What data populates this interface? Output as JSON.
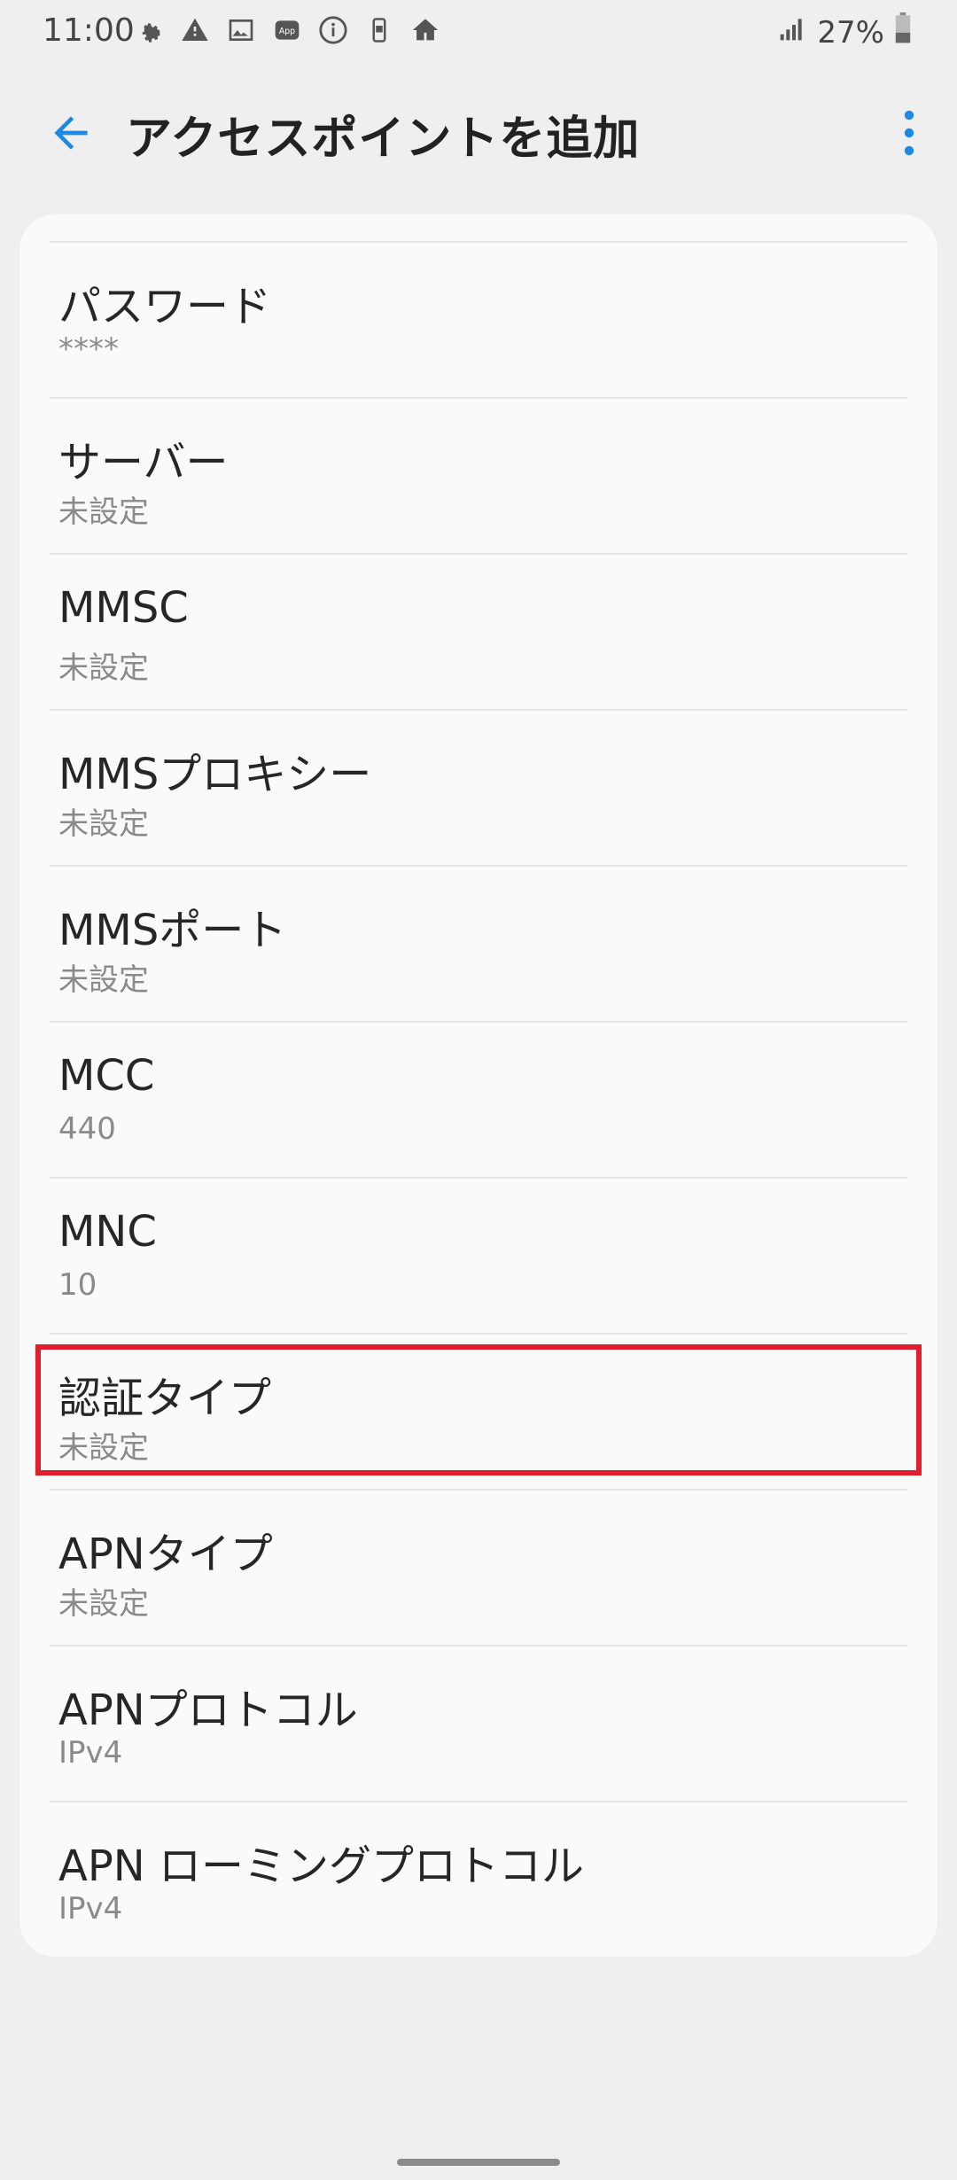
{
  "status_bar": {
    "time": "11:00",
    "battery_percent": "27%",
    "left_icons": [
      "gear-icon",
      "warning-icon",
      "image-icon",
      "app-icon",
      "info-icon",
      "device-icon",
      "home-icon"
    ],
    "right_icons": [
      "signal-icon",
      "battery-icon"
    ]
  },
  "app_bar": {
    "title": "アクセスポイントを追加",
    "accent_color": "#1e88e5"
  },
  "items": [
    {
      "title": "パスワード",
      "value": "****"
    },
    {
      "title": "サーバー",
      "value": "未設定"
    },
    {
      "title": "MMSC",
      "value": "未設定"
    },
    {
      "title": "MMSプロキシー",
      "value": "未設定"
    },
    {
      "title": "MMSポート",
      "value": "未設定"
    },
    {
      "title": "MCC",
      "value": "440"
    },
    {
      "title": "MNC",
      "value": "10"
    },
    {
      "title": "認証タイプ",
      "value": "未設定"
    },
    {
      "title": "APNタイプ",
      "value": "未設定"
    },
    {
      "title": "APNプロトコル",
      "value": "IPv4"
    },
    {
      "title": "APN ローミングプロトコル",
      "value": "IPv4"
    }
  ],
  "highlight_color": "#e01e2d"
}
